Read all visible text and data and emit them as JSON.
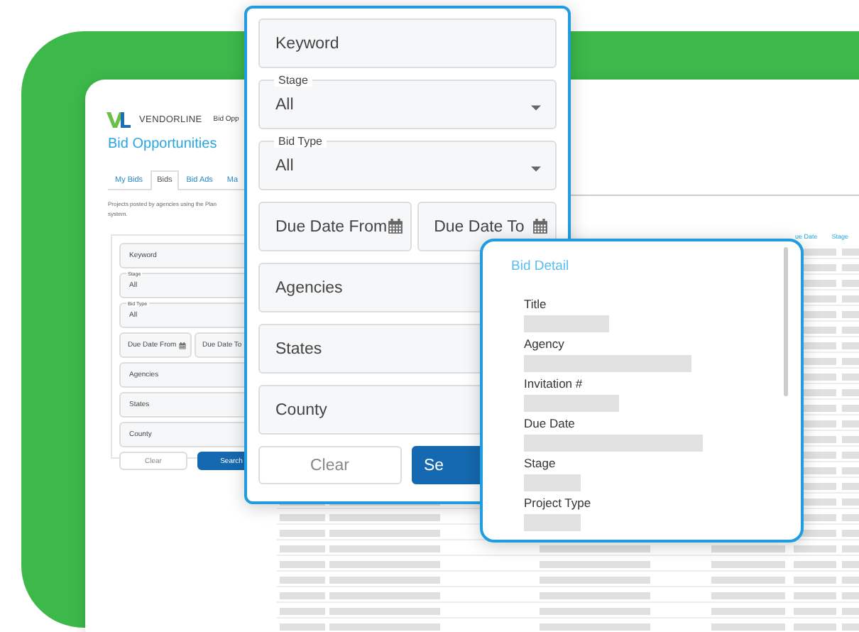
{
  "app": {
    "logo": "VENDORLINE",
    "header_link": "Bid Opp",
    "title": "Bid Opportunities",
    "tabs": [
      {
        "label": "My Bids",
        "selected": false
      },
      {
        "label": "Bids",
        "selected": true
      },
      {
        "label": "Bid Ads",
        "selected": false
      },
      {
        "label": "Ma",
        "selected": false
      }
    ],
    "description": [
      "Projects posted by agencies using the Plan",
      "system."
    ],
    "table": {
      "columns": [
        "ue Date",
        "Stage"
      ]
    }
  },
  "small_filter": {
    "fields": [
      {
        "kind": "text",
        "label": "Keyword"
      },
      {
        "kind": "select",
        "legend": "Stage",
        "value": "All"
      },
      {
        "kind": "select",
        "legend": "Bid Type",
        "value": "All"
      },
      {
        "kind": "dates",
        "from": "Due Date From",
        "to": "Due Date To"
      },
      {
        "kind": "text",
        "label": "Agencies"
      },
      {
        "kind": "text",
        "label": "States"
      },
      {
        "kind": "text",
        "label": "County"
      }
    ],
    "buttons": [
      {
        "kind": "secondary",
        "label": "Clear"
      },
      {
        "kind": "primary",
        "label": "Search"
      }
    ]
  },
  "filter_panel": {
    "fields": [
      {
        "kind": "text",
        "label": "Keyword"
      },
      {
        "kind": "select",
        "legend": "Stage",
        "value": "All"
      },
      {
        "kind": "select",
        "legend": "Bid Type",
        "value": "All"
      },
      {
        "kind": "dates",
        "from": "Due Date From",
        "to": "Due Date To"
      },
      {
        "kind": "text",
        "label": "Agencies"
      },
      {
        "kind": "text",
        "label": "States"
      },
      {
        "kind": "text",
        "label": "County"
      }
    ],
    "buttons": [
      {
        "kind": "secondary",
        "label": "Clear"
      },
      {
        "kind": "primary",
        "label": "Se"
      }
    ]
  },
  "bid_detail": {
    "title": "Bid Detail",
    "fields": [
      "Title",
      "Agency",
      "Invitation #",
      "Due Date",
      "Stage",
      "Project Type"
    ]
  }
}
